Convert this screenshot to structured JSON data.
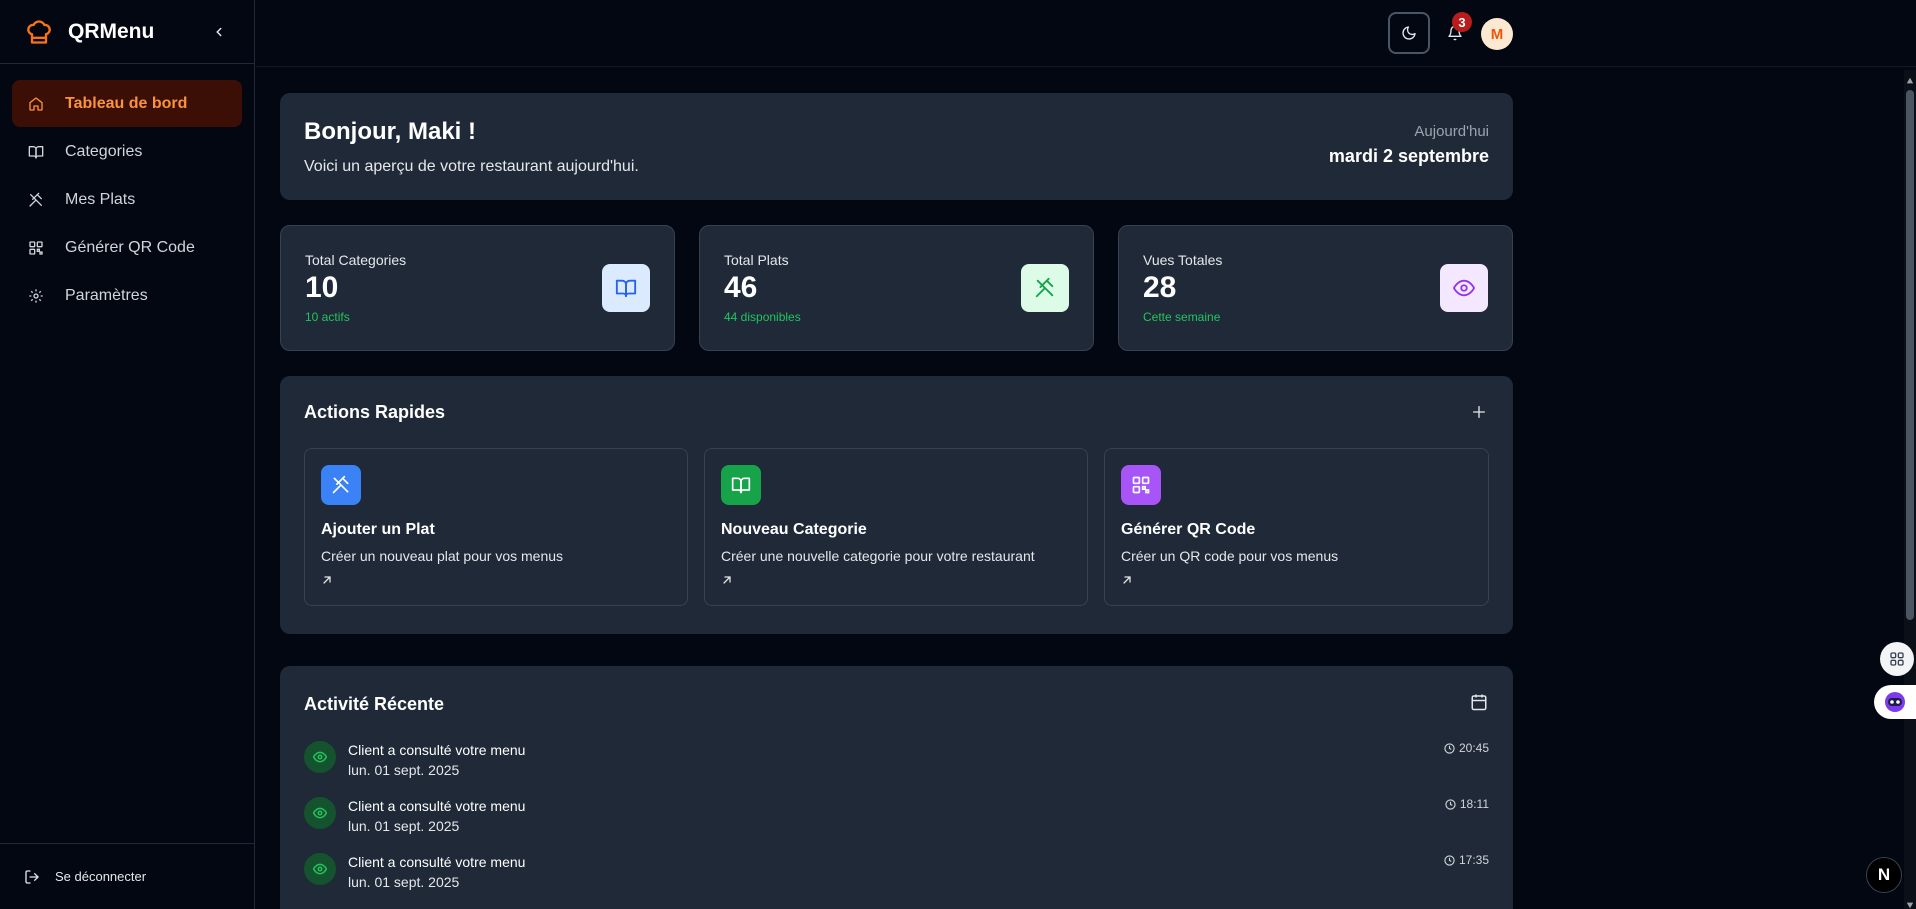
{
  "brand": {
    "name": "QRMenu"
  },
  "sidebar": {
    "items": [
      {
        "label": "Tableau de bord",
        "icon": "home-icon",
        "active": true
      },
      {
        "label": "Categories",
        "icon": "book-open-icon"
      },
      {
        "label": "Mes Plats",
        "icon": "utensils-crossed-icon"
      },
      {
        "label": "Générer QR Code",
        "icon": "qr-code-icon"
      },
      {
        "label": "Paramètres",
        "icon": "gear-icon"
      }
    ],
    "logout_label": "Se déconnecter"
  },
  "topbar": {
    "notification_count": "3",
    "avatar_initial": "M"
  },
  "welcome": {
    "title": "Bonjour, Maki !",
    "subtitle": "Voici un aperçu de votre restaurant aujourd'hui.",
    "today_label": "Aujourd'hui",
    "today_date": "mardi 2 septembre"
  },
  "stats": [
    {
      "label": "Total Categories",
      "value": "10",
      "sub": "10 actifs",
      "icon": "book-open-icon",
      "icon_bg": "#dbeafe",
      "icon_color": "#2563eb"
    },
    {
      "label": "Total Plats",
      "value": "46",
      "sub": "44 disponibles",
      "icon": "utensils-crossed-icon",
      "icon_bg": "#dcfce7",
      "icon_color": "#16a34a"
    },
    {
      "label": "Vues Totales",
      "value": "28",
      "sub": "Cette semaine",
      "icon": "eye-icon",
      "icon_bg": "#f3e8ff",
      "icon_color": "#9333ea"
    }
  ],
  "actions": {
    "title": "Actions Rapides",
    "items": [
      {
        "title": "Ajouter un Plat",
        "desc": "Créer un nouveau plat pour vos menus",
        "icon": "utensils-crossed-icon",
        "color": "#3b82f6"
      },
      {
        "title": "Nouveau Categorie",
        "desc": "Créer une nouvelle categorie pour votre restaurant",
        "icon": "book-open-icon",
        "color": "#16a34a"
      },
      {
        "title": "Générer QR Code",
        "desc": "Créer un QR code pour vos menus",
        "icon": "qr-code-icon",
        "color": "#a855f7"
      }
    ]
  },
  "activity": {
    "title": "Activité Récente",
    "items": [
      {
        "title": "Client a consulté votre menu",
        "date": "lun. 01 sept. 2025",
        "time": "20:45"
      },
      {
        "title": "Client a consulté votre menu",
        "date": "lun. 01 sept. 2025",
        "time": "18:11"
      },
      {
        "title": "Client a consulté votre menu",
        "date": "lun. 01 sept. 2025",
        "time": "17:35"
      }
    ]
  },
  "colors": {
    "accent": "#f97316",
    "active_bg": "#3b0f06",
    "card_bg": "#1f2937",
    "page_bg": "#030712",
    "success": "#22c55e"
  },
  "floating": {
    "next_label": "N"
  }
}
